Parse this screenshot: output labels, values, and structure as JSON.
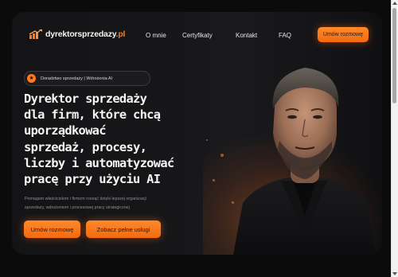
{
  "brand": {
    "name": "dyrektorsprzedazy",
    "tld": ".pl"
  },
  "nav": {
    "items": [
      "O mnie",
      "Certyfikaty",
      "Kontakt",
      "FAQ"
    ],
    "cta_label": "Umów rozmowę"
  },
  "hero": {
    "badge_text": "Doradztwo sprzedaży | Wdrożenia AI",
    "headline_lines": [
      "Dyrektor sprzedaży",
      "dla firm, które chcą",
      "uporządkować",
      "sprzedaż, procesy,",
      "liczby i automatyzować",
      "pracę przy użyciu AI"
    ],
    "description_lines": [
      "Pomagam właścicielom i firmom rosnąć dzięki lepszej organizacji",
      "sprzedaży, wdrożeniom i procesowej pracy strategicznej"
    ],
    "primary_cta": "Umów rozmowę",
    "secondary_cta": "Zobacz pełne usługi"
  },
  "colors": {
    "accent": "#ff7a1a",
    "background": "#0b0b0c",
    "card": "#151517"
  },
  "icons": {
    "logo": "rising-arrows-icon",
    "badge": "star-icon"
  }
}
